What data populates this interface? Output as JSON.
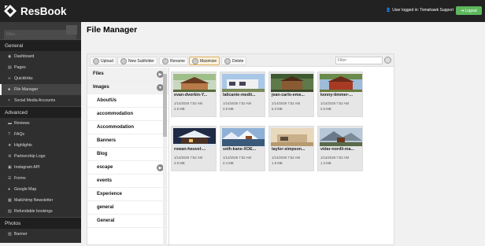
{
  "app": {
    "name": "ResBook"
  },
  "header": {
    "user_text": "User logged in: Tomahawk Support",
    "logout_label": "Logout"
  },
  "sidebar": {
    "filter_placeholder": "Filter...",
    "sections": [
      {
        "title": "General",
        "items": [
          {
            "label": "Dashboard",
            "icon": "dashboard-icon"
          },
          {
            "label": "Pages",
            "icon": "pages-icon"
          },
          {
            "label": "Quicklinks",
            "icon": "link-icon"
          },
          {
            "label": "File Manager",
            "icon": "folder-icon",
            "active": true
          },
          {
            "label": "Social Media Accounts",
            "icon": "share-icon"
          }
        ]
      },
      {
        "title": "Advanced",
        "items": [
          {
            "label": "Reviews",
            "icon": "reviews-icon"
          },
          {
            "label": "FAQs",
            "icon": "question-icon"
          },
          {
            "label": "Highlights",
            "icon": "star-icon"
          },
          {
            "label": "Partnership Logo",
            "icon": "gear-icon"
          },
          {
            "label": "Instagram API",
            "icon": "instagram-icon"
          },
          {
            "label": "Forms",
            "icon": "forms-icon"
          },
          {
            "label": "Google Map",
            "icon": "map-marker-icon"
          },
          {
            "label": "Mailchimp Newsletter",
            "icon": "mailchimp-icon"
          },
          {
            "label": "Refundable bookings",
            "icon": "bookings-icon"
          }
        ]
      },
      {
        "title": "Photos",
        "items": [
          {
            "label": "Banner",
            "icon": "image-icon"
          }
        ]
      }
    ]
  },
  "page": {
    "title": "File Manager"
  },
  "toolbar": {
    "upload": "Upload",
    "new_subfolder": "New Subfolder",
    "rename": "Rename",
    "maximize": "Maximize",
    "delete": "Delete",
    "filter_placeholder": "Filter"
  },
  "tree": {
    "items": [
      {
        "label": "Files",
        "level": 1,
        "arrow": "right"
      },
      {
        "label": "Images",
        "level": 1,
        "arrow": "down"
      },
      {
        "label": "AboutUs",
        "level": 2
      },
      {
        "label": "accommodation",
        "level": 2
      },
      {
        "label": "Accommodation",
        "level": 2
      },
      {
        "label": "Banners",
        "level": 2
      },
      {
        "label": "Blog",
        "level": 2
      },
      {
        "label": "escape",
        "level": 2,
        "arrow": "right"
      },
      {
        "label": "events",
        "level": 2
      },
      {
        "label": "Experience",
        "level": 2
      },
      {
        "label": "general",
        "level": 2
      },
      {
        "label": "General",
        "level": 2
      }
    ]
  },
  "files": [
    {
      "name": "evan-dvorkin-Y...",
      "date": "1/14/2026 7:52 AM",
      "size": "2.5 MB",
      "scene": "cabin-forest"
    },
    {
      "name": "lalicante-medit...",
      "date": "1/14/2026 7:52 AM",
      "size": "2.6 MB",
      "scene": "house-white"
    },
    {
      "name": "jean-carlo-eme...",
      "date": "1/14/2026 7:52 AM",
      "size": "5.3 MB",
      "scene": "cabin-green"
    },
    {
      "name": "kenny-timmer-...",
      "date": "1/14/2026 7:52 AM",
      "size": "2.6 MB",
      "scene": "red-house"
    },
    {
      "name": "rowan-heuvel-...",
      "date": "1/14/2026 7:52 AM",
      "size": "4.9 MB",
      "scene": "snow-cabin"
    },
    {
      "name": "seth-kane-XOE...",
      "date": "1/14/2026 7:52 AM",
      "size": "2.4 MB",
      "scene": "snow-lake"
    },
    {
      "name": "taylor-simpson...",
      "date": "1/14/2026 7:52 AM",
      "size": "1.8 MB",
      "scene": "desert-house"
    },
    {
      "name": "vidar-nordli-ma...",
      "date": "1/14/2026 7:52 AM",
      "size": "1.3 MB",
      "scene": "mountain-cabin"
    }
  ]
}
